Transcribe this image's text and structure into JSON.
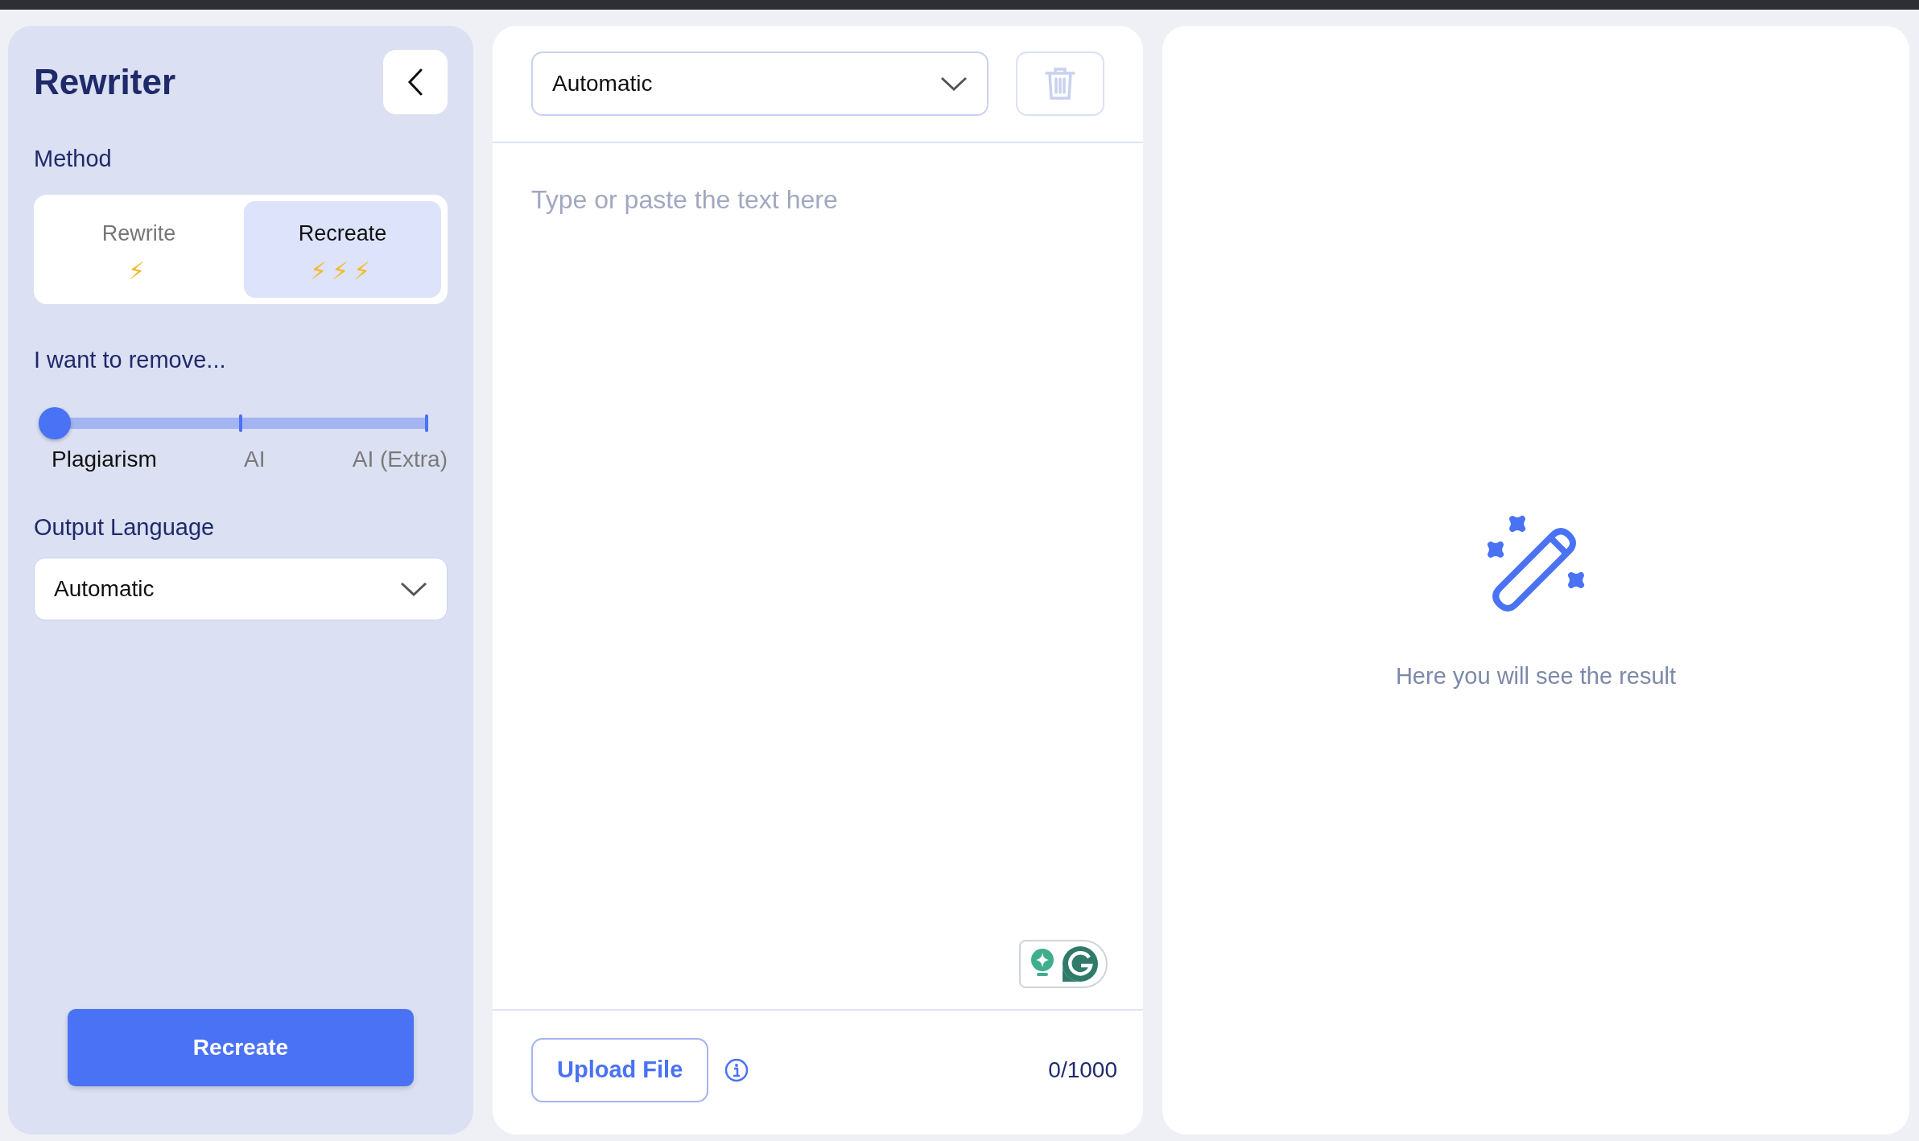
{
  "sidebar": {
    "title": "Rewriter",
    "method_label": "Method",
    "methods": [
      {
        "label": "Rewrite",
        "bolts": "⚡",
        "selected": false
      },
      {
        "label": "Recreate",
        "bolts": "⚡⚡⚡",
        "selected": true
      }
    ],
    "remove": {
      "label": "I want to remove...",
      "level": 0,
      "stops": [
        {
          "label": "Plagiarism",
          "selected": true
        },
        {
          "label": "AI",
          "selected": false
        },
        {
          "label": "AI (Extra)",
          "selected": false
        }
      ]
    },
    "output_language": {
      "label": "Output Language",
      "value": "Automatic"
    },
    "action": "Recreate"
  },
  "editor": {
    "language": "Automatic",
    "placeholder": "Type or paste the text here",
    "upload": "Upload File",
    "counter": "0/1000"
  },
  "result": {
    "message": "Here you will see the result"
  }
}
